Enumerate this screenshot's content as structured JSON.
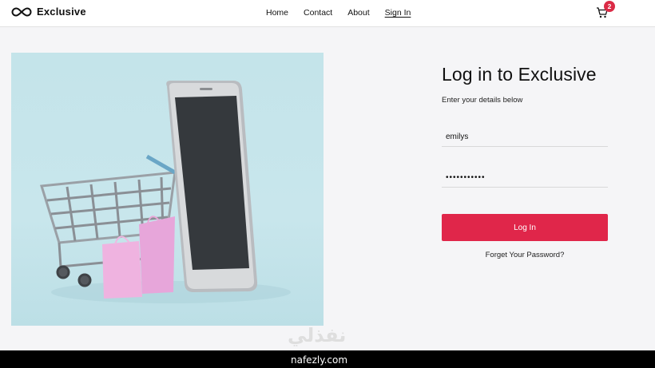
{
  "header": {
    "logo_text": "Exclusive",
    "nav": {
      "home": "Home",
      "contact": "Contact",
      "about": "About",
      "sign_in": "Sign In"
    },
    "cart_count": "2",
    "cart_icon": "cart-icon",
    "logo_icon": "infinity-icon"
  },
  "login": {
    "title": "Log in to Exclusive",
    "subtitle": "Enter your details below",
    "username_value": "emilys",
    "password_value": "•••••••••••",
    "submit_label": "Log In",
    "forgot_link": "Forget Your Password?"
  },
  "watermark": {
    "arabic": "نفذلي",
    "domain": "nafezly.com"
  },
  "colors": {
    "accent": "#DB2B46",
    "hero_bg": "#C4E4EA"
  }
}
